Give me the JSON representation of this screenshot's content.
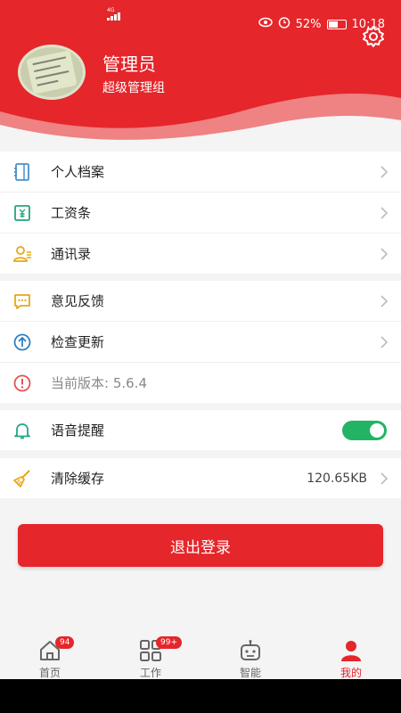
{
  "status_bar": {
    "network": "4G",
    "battery": "52%",
    "time": "10:18"
  },
  "profile": {
    "name": "管理员",
    "role": "超级管理组"
  },
  "menu_group_1": [
    {
      "label": "个人档案",
      "icon": "profile-file-icon"
    },
    {
      "label": "工资条",
      "icon": "salary-slip-icon"
    },
    {
      "label": "通讯录",
      "icon": "contacts-icon"
    }
  ],
  "menu_group_2": [
    {
      "label": "意见反馈",
      "icon": "feedback-icon"
    },
    {
      "label": "检查更新",
      "icon": "update-icon"
    },
    {
      "label": "当前版本: 5.6.4",
      "icon": "version-info-icon"
    }
  ],
  "voice": {
    "label": "语音提醒",
    "enabled": true
  },
  "cache": {
    "label": "清除缓存",
    "size": "120.65KB"
  },
  "logout_label": "退出登录",
  "tabbar": [
    {
      "label": "首页",
      "badge": "94",
      "icon": "home-icon"
    },
    {
      "label": "工作",
      "badge": "99+",
      "icon": "work-grid-icon"
    },
    {
      "label": "智能",
      "badge": "",
      "icon": "robot-icon"
    },
    {
      "label": "我的",
      "badge": "",
      "icon": "user-icon",
      "active": true
    }
  ],
  "colors": {
    "primary": "#e5262b",
    "toggle_on": "#22b464"
  }
}
